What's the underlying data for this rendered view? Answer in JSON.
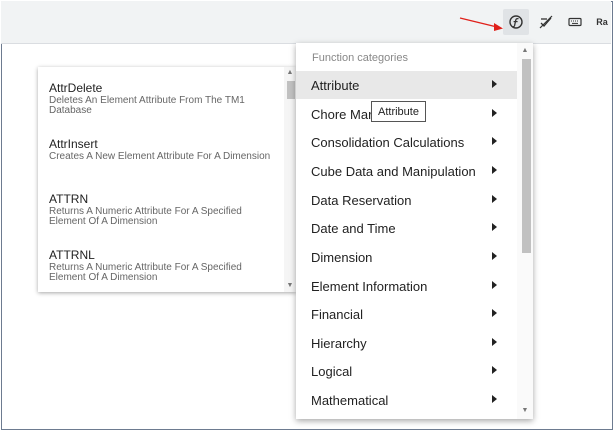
{
  "toolbar": {
    "buttons": [
      {
        "icon": "function-icon",
        "active": true
      },
      {
        "icon": "no-formula-icon",
        "active": false
      },
      {
        "icon": "keyboard-icon",
        "active": false
      },
      {
        "icon": "ra-icon",
        "label": "Ra",
        "active": false
      }
    ],
    "annotation_arrow_color": "#e0201a"
  },
  "function_list": {
    "items": [
      {
        "name": "AttrDelete",
        "description": "Deletes An Element Attribute From The TM1 Database"
      },
      {
        "name": "AttrInsert",
        "description": "Creates A New Element Attribute For A Dimension"
      },
      {
        "name": "ATTRN",
        "description": "Returns A Numeric Attribute For A Specified Element Of A Dimension"
      },
      {
        "name": "ATTRNL",
        "description": "Returns A Numeric Attribute For A Specified Element Of A Dimension"
      }
    ]
  },
  "category_menu": {
    "header": "Function categories",
    "selected": "Attribute",
    "items": [
      {
        "label": "Attribute"
      },
      {
        "label": "Chore Mar"
      },
      {
        "label": "Consolidation Calculations"
      },
      {
        "label": "Cube Data and Manipulation"
      },
      {
        "label": "Data Reservation"
      },
      {
        "label": "Date and Time"
      },
      {
        "label": "Dimension"
      },
      {
        "label": "Element Information"
      },
      {
        "label": "Financial"
      },
      {
        "label": "Hierarchy"
      },
      {
        "label": "Logical"
      },
      {
        "label": "Mathematical"
      }
    ]
  },
  "tooltip": {
    "text": "Attribute"
  },
  "colors": {
    "toolbar_bg": "#f1f3f4",
    "selected_bg": "#e8e8e8",
    "frame_border": "#6d7b90"
  }
}
